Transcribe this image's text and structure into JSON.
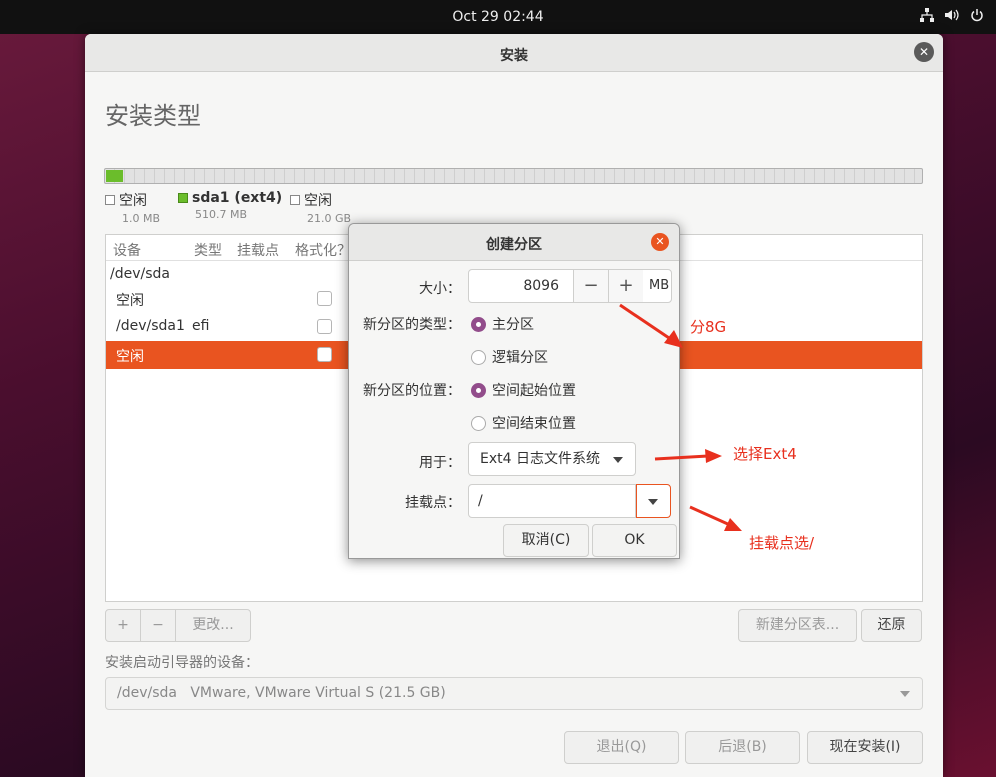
{
  "topbar": {
    "clock": "Oct 29  02:44",
    "tray_icons": [
      "network-icon",
      "volume-icon",
      "power-icon"
    ]
  },
  "window": {
    "title": "安装",
    "heading": "安装类型"
  },
  "legend": [
    {
      "label": "空闲",
      "size": "1.0 MB",
      "color": "#ffffff"
    },
    {
      "label": "sda1 (ext4)",
      "size": "510.7 MB",
      "color": "#6bbd2b"
    },
    {
      "label": "空闲",
      "size": "21.0 GB",
      "color": "#ffffff"
    }
  ],
  "table": {
    "headers": {
      "device": "设备",
      "type": "类型",
      "mount": "挂载点",
      "format": "格式化？"
    },
    "rows": [
      {
        "device": "/dev/sda",
        "type": "",
        "checkbox": false
      },
      {
        "device": "空闲",
        "type": "",
        "checkbox": true
      },
      {
        "device": "/dev/sda1",
        "type": "efi",
        "checkbox": true
      },
      {
        "device": "空闲",
        "type": "",
        "checkbox": true,
        "selected": true
      }
    ]
  },
  "buttons": {
    "add": "+",
    "remove": "−",
    "change": "更改...",
    "new_table": "新建分区表...",
    "revert": "还原",
    "quit": "退出(Q)",
    "back": "后退(B)",
    "install_now": "现在安装(I)"
  },
  "boot": {
    "label": "安装启动引导器的设备：",
    "device": "/dev/sda",
    "desc": "VMware, VMware Virtual S (21.5 GB)"
  },
  "dialog": {
    "title": "创建分区",
    "size_label": "大小：",
    "size_value": "8096",
    "minus": "−",
    "plus": "+",
    "unit": "MB",
    "type_label": "新分区的类型：",
    "type_primary": "主分区",
    "type_logical": "逻辑分区",
    "location_label": "新分区的位置：",
    "loc_start": "空间起始位置",
    "loc_end": "空间结束位置",
    "use_label": "用于：",
    "use_value": "Ext4 日志文件系统",
    "mount_label": "挂载点：",
    "mount_value": "/",
    "cancel": "取消(C)",
    "ok": "OK"
  },
  "annotations": {
    "size_note": "分8G",
    "fs_note": "选择Ext4",
    "mount_note": "挂载点选/"
  },
  "colors": {
    "accent": "#e95420",
    "radio": "#924d8b",
    "annotation": "#e8301e",
    "partition_used": "#6bbd2b"
  }
}
